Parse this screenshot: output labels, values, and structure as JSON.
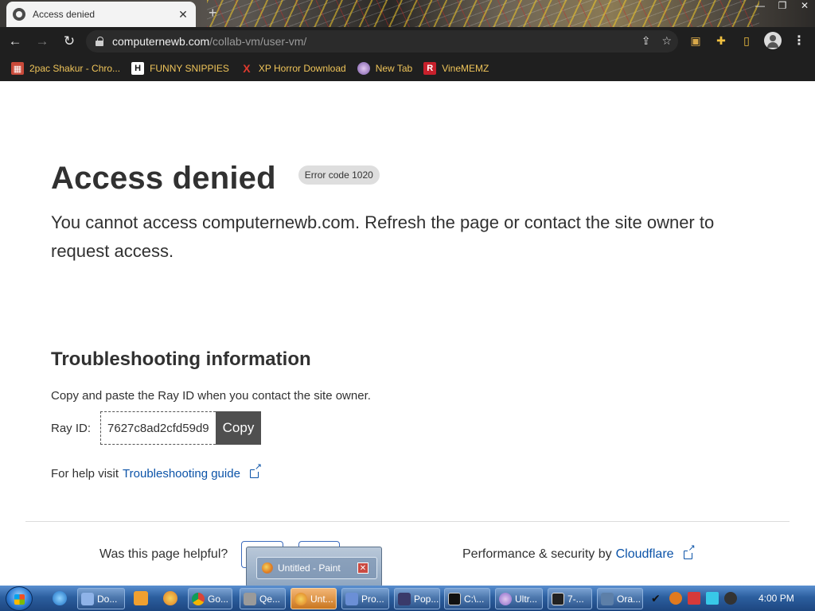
{
  "browser": {
    "tab_title": "Access denied",
    "url_host": "computernewb.com",
    "url_path": "/collab-vm/user-vm/",
    "bookmarks": [
      {
        "label": "2pac Shakur - Chro...",
        "icon": "image-icon",
        "color": "#c94a3a"
      },
      {
        "label": "FUNNY SNIPPIES",
        "icon": "H",
        "color": "#ffffff"
      },
      {
        "label": "XP Horror Download",
        "icon": "X",
        "color": "#e03a2e"
      },
      {
        "label": "New Tab",
        "icon": "globe-icon",
        "color": "#7a5aa8"
      },
      {
        "label": "VineMEMZ",
        "icon": "R",
        "color": "#c8202c"
      }
    ]
  },
  "page": {
    "title": "Access denied",
    "error_badge": "Error code 1020",
    "lead": "You cannot access computernewb.com. Refresh the page or contact the site owner to request access.",
    "troubleshooting_title": "Troubleshooting information",
    "copy_hint": "Copy and paste the Ray ID when you contact the site owner.",
    "ray_label": "Ray ID:",
    "ray_id": "7627c8ad2cfd59d9",
    "copy_button": "Copy",
    "help_prefix": "For help visit",
    "help_link": "Troubleshooting guide",
    "helpful_question": "Was this page helpful?",
    "perf_prefix": "Performance & security by",
    "perf_link": "Cloudflare"
  },
  "thumbnail": {
    "title": "Untitled - Paint"
  },
  "taskbar": {
    "buttons": [
      {
        "label": "Do...",
        "color": "#8fb3e8"
      },
      {
        "label": "Go...",
        "color": "#4caf50"
      },
      {
        "label": "Qe...",
        "color": "#9a9a9a"
      },
      {
        "label": "Unt...",
        "color": "#f4d35e"
      },
      {
        "label": "Pro...",
        "color": "#6b8fd6"
      },
      {
        "label": "Pop...",
        "color": "#3a3a6a"
      },
      {
        "label": "C:\\...",
        "color": "#111111"
      },
      {
        "label": "Ultr...",
        "color": "#8a6ac8"
      },
      {
        "label": "7-...",
        "color": "#222222"
      },
      {
        "label": "Ora...",
        "color": "#5d7fa8"
      }
    ],
    "clock": "4:00 PM"
  },
  "colors": {
    "link": "#0b53a8",
    "copy_button_bg": "#4f4f4f",
    "bookmark_text": "#f0c55a"
  }
}
